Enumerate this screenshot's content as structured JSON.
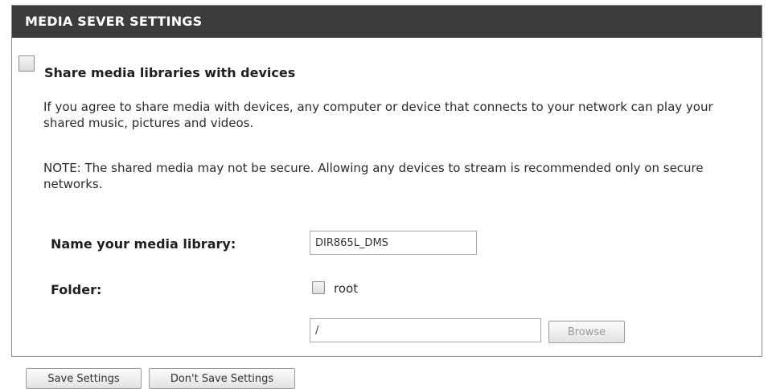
{
  "panel": {
    "title": "MEDIA SEVER SETTINGS"
  },
  "share": {
    "label": "Share media libraries with devices",
    "checked": false
  },
  "info": {
    "agree_text": "If you agree to share media with devices, any computer or device that connects to your network can play your shared music, pictures and videos.",
    "note_text": "NOTE: The shared media may not be secure. Allowing any devices to stream is recommended only on secure networks."
  },
  "library": {
    "name_label": "Name your media library:",
    "name_value": "DIR865L_DMS"
  },
  "folder": {
    "label": "Folder:",
    "root_label": "root",
    "root_checked": false,
    "path_value": "/",
    "browse_label": "Browse"
  },
  "actions": {
    "save_label": "Save Settings",
    "dont_save_label": "Don't Save Settings"
  },
  "colors": {
    "header_bg": "#3c3c3c",
    "header_text": "#ffffff",
    "border": "#8a8a8a"
  }
}
